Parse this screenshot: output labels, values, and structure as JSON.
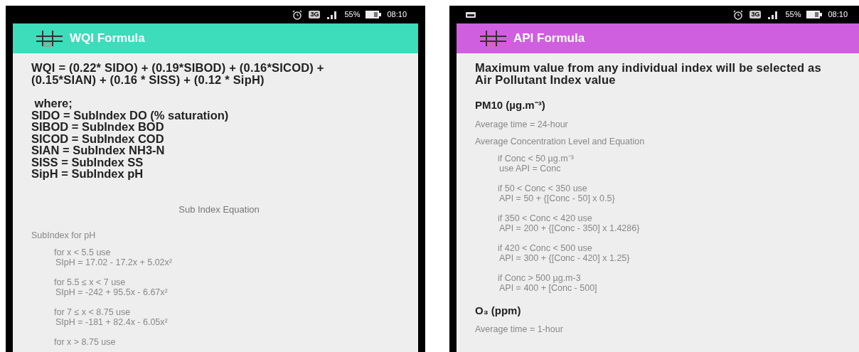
{
  "phones": [
    {
      "status_bar": {
        "notification": false,
        "network": "3G",
        "battery": "55%",
        "time": "08:10"
      },
      "app_bar": {
        "title": "WQI Formula",
        "color": "#3ddcbb"
      },
      "content": [
        {
          "kind": "formula",
          "text": "WQI = (0.22* SIDO) + (0.19*SIBOD) + (0.16*SICOD) + (0.15*SIAN) + (0.16 * SISS) + (0.12 * SipH)"
        },
        {
          "kind": "definitions",
          "lines": [
            " where;",
            "SIDO = SubIndex DO (% saturation)",
            "SIBOD = SubIndex BOD",
            "SICOD = SubIndex COD",
            "SIAN = SubIndex NH3-N",
            "SISS = SubIndex SS",
            "SipH = SubIndex pH"
          ]
        },
        {
          "kind": "center-heading",
          "text": "Sub Index Equation"
        },
        {
          "kind": "label",
          "text": "SubIndex for pH"
        },
        {
          "kind": "case",
          "condition": "for x < 5.5 use",
          "equation": "SIpH = 17.02 - 17.2x + 5.02x²"
        },
        {
          "kind": "case",
          "condition": "for 5.5 ≤ x < 7 use",
          "equation": "SIpH = -242 + 95.5x - 6.67x²"
        },
        {
          "kind": "case",
          "condition": "for 7 ≤ x < 8.75 use",
          "equation": "SIpH = -181 + 82.4x - 6.05x²"
        },
        {
          "kind": "label-indent",
          "text": "for x > 8.75 use"
        }
      ]
    },
    {
      "status_bar": {
        "notification": true,
        "network": "3G",
        "battery": "55%",
        "time": "08:10"
      },
      "app_bar": {
        "title": "API Formula",
        "color": "#d05fe0"
      },
      "content": [
        {
          "kind": "formula",
          "text": "Maximum value from any individual index will be selected as Air Pollutant Index value"
        },
        {
          "kind": "section",
          "text": "PM10 (µg.m⁻³)"
        },
        {
          "kind": "label",
          "text": "Average time = 24-hour"
        },
        {
          "kind": "label",
          "text": "Average Concentration Level and Equation"
        },
        {
          "kind": "case",
          "condition": "if Conc < 50 µg.m⁻³",
          "equation": "use API = Conc"
        },
        {
          "kind": "case",
          "condition": "if 50 < Conc < 350 use",
          "equation": "API = 50 + {[Conc - 50] x 0.5}"
        },
        {
          "kind": "case",
          "condition": "if 350 < Conc < 420 use",
          "equation": "API = 200 + {[Conc - 350] x 1.4286}"
        },
        {
          "kind": "case",
          "condition": "if 420 < Conc < 500 use",
          "equation": "API = 300 + {[Conc - 420] x 1.25}"
        },
        {
          "kind": "case",
          "condition": "if Conc > 500 µg.m-3",
          "equation": "API = 400 + [Conc - 500]"
        },
        {
          "kind": "section",
          "text": "O₃ (ppm)"
        },
        {
          "kind": "label",
          "text": "Average time = 1-hour"
        }
      ]
    }
  ]
}
